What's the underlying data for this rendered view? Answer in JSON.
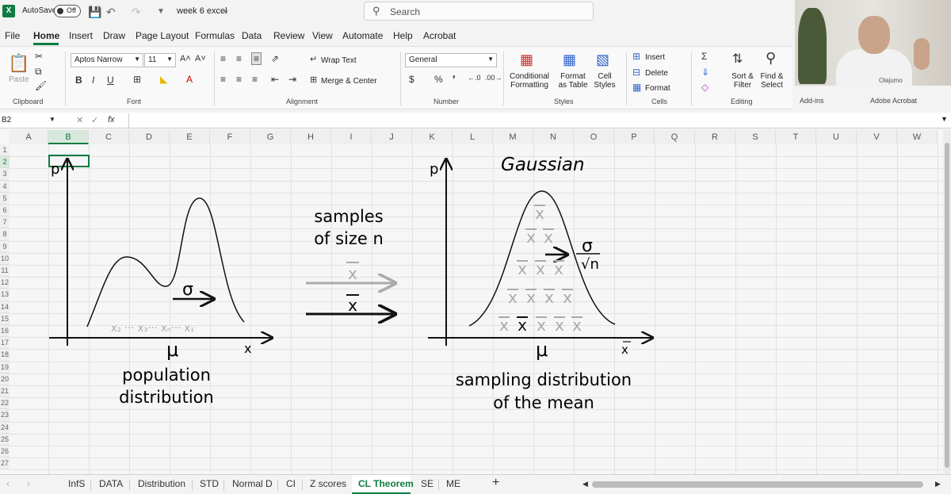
{
  "titlebar": {
    "autosave_label": "AutoSave",
    "autosave_state": "Off",
    "file_name": "week 6 excel",
    "search_placeholder": "Search"
  },
  "menu": [
    "File",
    "Home",
    "Insert",
    "Draw",
    "Page Layout",
    "Formulas",
    "Data",
    "Review",
    "View",
    "Automate",
    "Help",
    "Acrobat"
  ],
  "ribbon": {
    "clipboard": {
      "paste": "Paste",
      "label": "Clipboard"
    },
    "font": {
      "name": "Aptos Narrow",
      "size": "11",
      "label": "Font"
    },
    "alignment": {
      "wrap": "Wrap Text",
      "merge": "Merge & Center",
      "label": "Alignment"
    },
    "number": {
      "format": "General",
      "label": "Number"
    },
    "styles": {
      "conditional": "Conditional Formatting",
      "table": "Format as Table",
      "cell": "Cell Styles",
      "label": "Styles"
    },
    "cells": {
      "insert": "Insert",
      "delete": "Delete",
      "format": "Format",
      "label": "Cells"
    },
    "editing": {
      "sort": "Sort & Filter",
      "find": "Find & Select",
      "label": "Editing"
    },
    "addins": {
      "label": "Add-ins"
    },
    "acrobat": {
      "label": "Adobe Acrobat"
    }
  },
  "formula_bar": {
    "cell_ref": "B2",
    "fx": "fx",
    "value": ""
  },
  "columns": [
    "A",
    "B",
    "C",
    "D",
    "E",
    "F",
    "G",
    "H",
    "I",
    "J",
    "K",
    "L",
    "M",
    "N",
    "O",
    "P",
    "Q",
    "R",
    "S",
    "T",
    "U",
    "V",
    "W"
  ],
  "rows": [
    "1",
    "2",
    "3",
    "4",
    "5",
    "6",
    "7",
    "8",
    "9",
    "10",
    "11",
    "12",
    "13",
    "14",
    "15",
    "16",
    "17",
    "18",
    "19",
    "20",
    "21",
    "22",
    "23",
    "24",
    "25",
    "26",
    "27"
  ],
  "diagram": {
    "left": {
      "p": "p",
      "x": "x",
      "mu": "μ",
      "sigma": "σ",
      "samples": "x₂ ··· x₃··· xₙ··· x₁",
      "caption_line1": "population",
      "caption_line2": "distribution"
    },
    "middle": {
      "line1": "samples",
      "line2": "of size n",
      "xbar": "x"
    },
    "right": {
      "p": "p",
      "title": "Gaussian",
      "sigma": "σ",
      "sqrt_n": "√n",
      "mu": "μ",
      "xbar_axis": "x",
      "xbar": "x",
      "caption_line1": "sampling distribution",
      "caption_line2": "of the mean"
    }
  },
  "sheet_tabs": [
    "InfS",
    "DATA",
    "Distribution",
    "STD",
    "Normal D",
    "CI",
    "Z scores",
    "CL Theorem",
    "SE",
    "ME"
  ],
  "active_tab": "CL Theorem",
  "webcam": {
    "sticker": "Olajumo"
  }
}
